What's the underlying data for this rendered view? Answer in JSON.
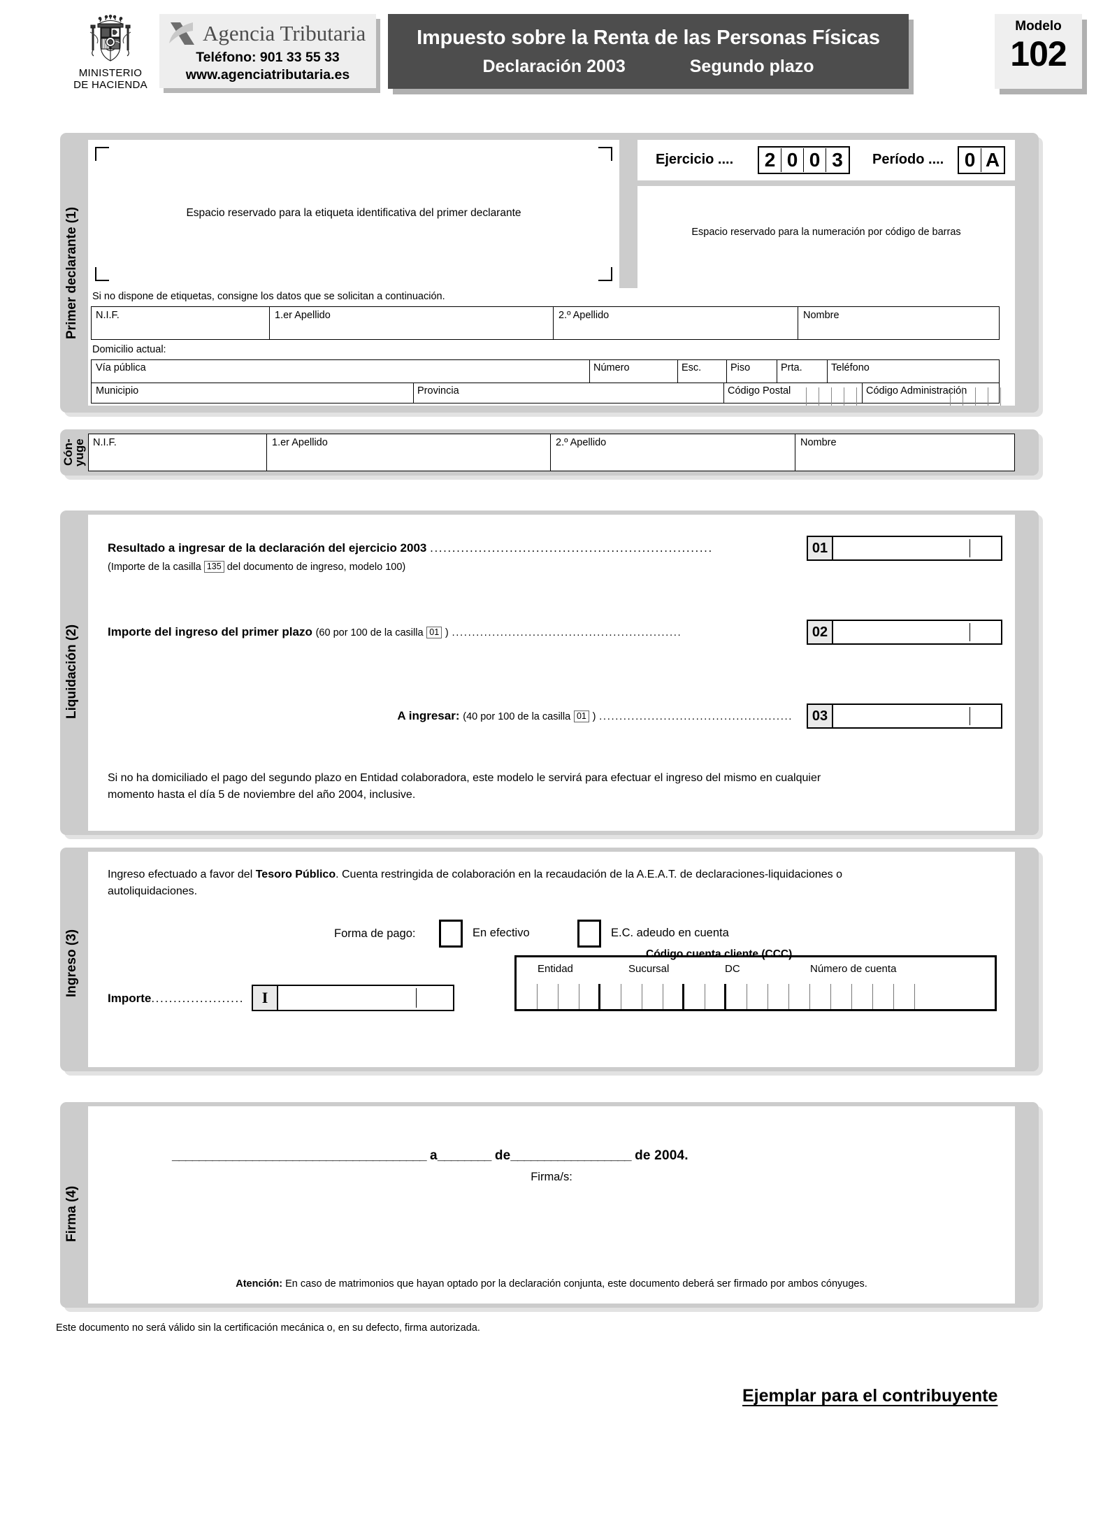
{
  "header": {
    "coat_ministerio_line1": "MINISTERIO",
    "coat_ministerio_line2": "DE HACIENDA",
    "agency_name": "Agencia Tributaria",
    "agency_phone": "Teléfono: 901 33 55 33",
    "agency_web": "www.agenciatributaria.es",
    "title_main": "Impuesto sobre la Renta de las Personas Físicas",
    "title_sub_left": "Declaración 2003",
    "title_sub_right": "Segundo plazo",
    "modelo_label": "Modelo",
    "modelo_number": "102"
  },
  "section1": {
    "side_label": "Primer declarante (1)",
    "label_space_text": "Espacio reservado para la etiqueta identificativa del primer declarante",
    "barcode_space_text": "Espacio reservado para la numeración por código de barras",
    "ejercicio_label": "Ejercicio ....",
    "ejercicio_digits": [
      "2",
      "0",
      "0",
      "3"
    ],
    "periodo_label": "Período ....",
    "periodo_digits": [
      "0",
      "A"
    ],
    "no_label_note": "Si no dispone de etiquetas, consigne los datos que se solicitan a continuación.",
    "fields": {
      "nif": "N.I.F.",
      "apellido1": "1.er Apellido",
      "apellido2": "2.º Apellido",
      "nombre": "Nombre"
    },
    "domicilio_label": "Domicilio actual:",
    "address_fields": {
      "via": "Vía pública",
      "numero": "Número",
      "esc": "Esc.",
      "piso": "Piso",
      "prta": "Prta.",
      "telefono": "Teléfono",
      "municipio": "Municipio",
      "provincia": "Provincia",
      "codigo_postal": "Código Postal",
      "codigo_administracion": "Código Administración"
    }
  },
  "conyuge": {
    "side_label_line1": "Cón-",
    "side_label_line2": "yuge",
    "fields": {
      "nif": "N.I.F.",
      "apellido1": "1.er Apellido",
      "apellido2": "2.º Apellido",
      "nombre": "Nombre"
    }
  },
  "section2": {
    "side_label": "Liquidación (2)",
    "rows": [
      {
        "number": "01",
        "label_bold": "Resultado a ingresar de la declaración del ejercicio 2003",
        "label_rest": "",
        "sub_pre": "(Importe de la casilla",
        "sub_box": "135",
        "sub_post": "del documento de ingreso, modelo 100)"
      },
      {
        "number": "02",
        "label_bold": "Importe del ingreso del primer plazo",
        "label_rest_pre": "(60 por 100 de la casilla",
        "label_box": "01",
        "label_rest_post": ")"
      },
      {
        "number": "03",
        "label_bold": "A ingresar:",
        "label_rest_pre": "(40 por 100 de la casilla",
        "label_box": "01",
        "label_rest_post": ")"
      }
    ],
    "notice_line1": "Si no ha domiciliado el pago del segundo plazo en Entidad colaboradora, este modelo le servirá para efectuar el ingreso del mismo en cualquier",
    "notice_line2": "momento hasta el día 5 de noviembre del año 2004, inclusive."
  },
  "section3": {
    "side_label": "Ingreso (3)",
    "intro_pre": "Ingreso efectuado a favor del ",
    "intro_bold": "Tesoro Público",
    "intro_post": ". Cuenta restringida de colaboración en la recaudación de la A.E.A.T. de declaraciones-liquidaciones o",
    "intro_line2": "autoliquidaciones.",
    "forma_pago_label": "Forma de pago:",
    "option_cash": "En efectivo",
    "option_account": "E.C. adeudo en cuenta",
    "importe_label": "Importe",
    "importe_dots": ".....................",
    "importe_symbol": "I",
    "ccc_title": "Código cuenta cliente (CCC)",
    "ccc_entidad": "Entidad",
    "ccc_sucursal": "Sucursal",
    "ccc_dc": "DC",
    "ccc_numero": "Número de cuenta"
  },
  "section4": {
    "side_label": "Firma (4)",
    "date_a": "a",
    "date_de1": "de",
    "date_de2": "de 2004.",
    "firma_label": "Firma/s:",
    "atencion_bold": "Atención:",
    "atencion_text": "En caso de matrimonios que hayan optado por la declaración conjunta, este documento deberá ser firmado por ambos cónyuges."
  },
  "footer": {
    "validity_note": "Este documento no será válido sin la certificación mecánica o, en su defecto, firma autorizada.",
    "copy_label": "Ejemplar para el contribuyente"
  }
}
